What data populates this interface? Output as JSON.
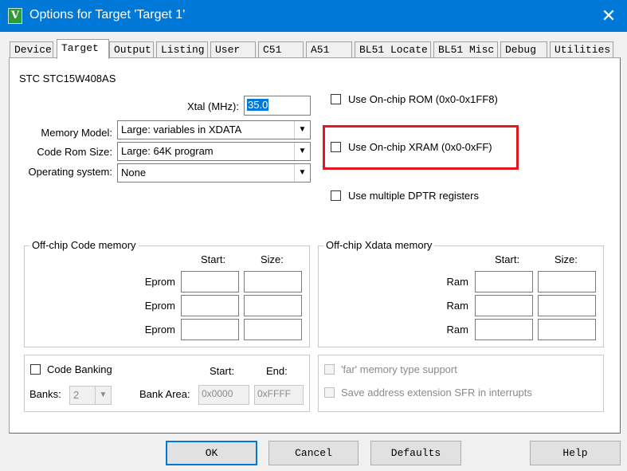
{
  "window": {
    "title": "Options for Target 'Target 1'",
    "icon_glyph": "V",
    "close_glyph": "✕"
  },
  "tabs": [
    {
      "label": "Device"
    },
    {
      "label": "Target",
      "active": true
    },
    {
      "label": "Output"
    },
    {
      "label": "Listing"
    },
    {
      "label": "User"
    },
    {
      "label": "C51"
    },
    {
      "label": "A51"
    },
    {
      "label": "BL51 Locate"
    },
    {
      "label": "BL51 Misc"
    },
    {
      "label": "Debug"
    },
    {
      "label": "Utilities"
    }
  ],
  "target": {
    "device_name": "STC STC15W408AS",
    "xtal_label": "Xtal (MHz):",
    "xtal_value": "35.0",
    "memory_model_label": "Memory Model:",
    "memory_model_value": "Large: variables in XDATA",
    "code_rom_label": "Code Rom Size:",
    "code_rom_value": "Large: 64K program",
    "os_label": "Operating system:",
    "os_value": "None",
    "onchip_rom_label": "Use On-chip ROM (0x0-0x1FF8)",
    "onchip_xram_label": "Use On-chip XRAM (0x0-0xFF)",
    "multi_dptr_label": "Use multiple DPTR registers"
  },
  "code_memory": {
    "title": "Off-chip Code memory",
    "start_header": "Start:",
    "size_header": "Size:",
    "rows": [
      {
        "label": "Eprom",
        "start": "",
        "size": ""
      },
      {
        "label": "Eprom",
        "start": "",
        "size": ""
      },
      {
        "label": "Eprom",
        "start": "",
        "size": ""
      }
    ]
  },
  "xdata_memory": {
    "title": "Off-chip Xdata memory",
    "start_header": "Start:",
    "size_header": "Size:",
    "rows": [
      {
        "label": "Ram",
        "start": "",
        "size": ""
      },
      {
        "label": "Ram",
        "start": "",
        "size": ""
      },
      {
        "label": "Ram",
        "start": "",
        "size": ""
      }
    ]
  },
  "banking": {
    "code_banking_label": "Code Banking",
    "banks_label": "Banks:",
    "banks_value": "2",
    "bank_area_label": "Bank Area:",
    "start_header": "Start:",
    "end_header": "End:",
    "start_value": "0x0000",
    "end_value": "0xFFFF"
  },
  "far": {
    "far_memory_label": "'far' memory type support",
    "save_sfr_label": "Save address extension SFR in interrupts"
  },
  "buttons": {
    "ok": "OK",
    "cancel": "Cancel",
    "defaults": "Defaults",
    "help": "Help"
  },
  "colors": {
    "titlebar": "#0078d7",
    "highlight": "#e0191f"
  }
}
